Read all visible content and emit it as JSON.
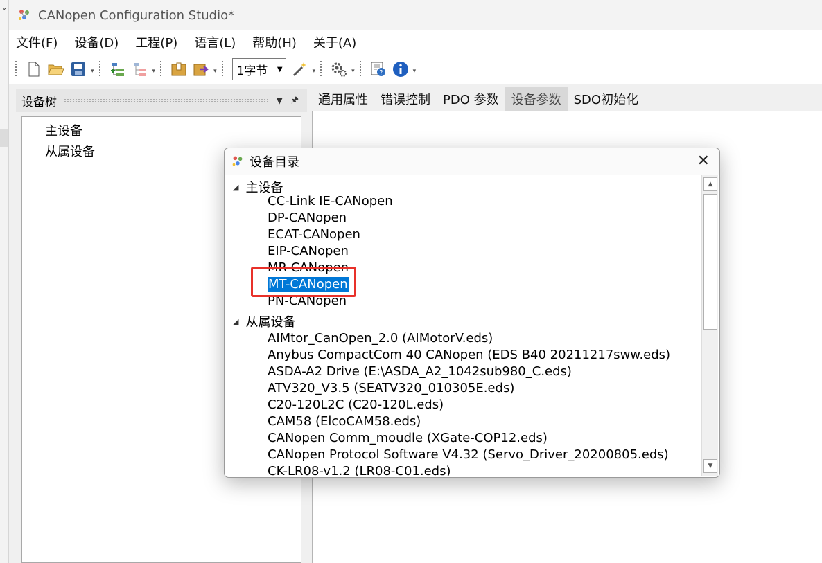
{
  "window": {
    "title": "CANopen Configuration Studio*"
  },
  "menu": [
    "文件(F)",
    "设备(D)",
    "工程(P)",
    "语言(L)",
    "帮助(H)",
    "关于(A)"
  ],
  "toolbar": {
    "byte_combo": "1字节",
    "icons": [
      "new-file-icon",
      "open-folder-icon",
      "save-icon",
      "add-node-icon",
      "remove-node-icon",
      "download-icon",
      "export-icon",
      "wand-icon",
      "settings-gear-icon",
      "help-icon",
      "info-icon"
    ]
  },
  "device_tree": {
    "title": "设备树",
    "nodes": [
      "主设备",
      "从属设备"
    ]
  },
  "tabs": [
    "通用属性",
    "错误控制",
    "PDO 参数",
    "设备参数",
    "SDO初始化"
  ],
  "active_tab_index": 3,
  "dialog": {
    "title": "设备目录",
    "close": "✕",
    "groups": [
      {
        "label": "主设备",
        "items": [
          "CC-Link IE-CANopen",
          "DP-CANopen",
          "ECAT-CANopen",
          "EIP-CANopen",
          "MR-CANopen",
          "MT-CANopen",
          "PN-CANopen"
        ]
      },
      {
        "label": "从属设备",
        "items": [
          "AIMtor_CanOpen_2.0 (AIMotorV.eds)",
          "Anybus CompactCom 40 CANopen (EDS B40 20211217sww.eds)",
          "ASDA-A2 Drive (E:\\ASDA_A2_1042sub980_C.eds)",
          "ATV320_V3.5 (SEATV320_010305E.eds)",
          "C20-120L2C (C20-120L.eds)",
          "CAM58 (ElcoCAM58.eds)",
          "CANopen Comm_moudle (XGate-COP12.eds)",
          "CANopen Protocol Software V4.32 (Servo_Driver_20200805.eds)",
          "CK-LR08-v1.2 (LR08-C01.eds)"
        ]
      }
    ],
    "selected_item": "MT-CANopen"
  },
  "colors": {
    "selection": "#0078d7",
    "highlight_box": "#e8312a"
  }
}
